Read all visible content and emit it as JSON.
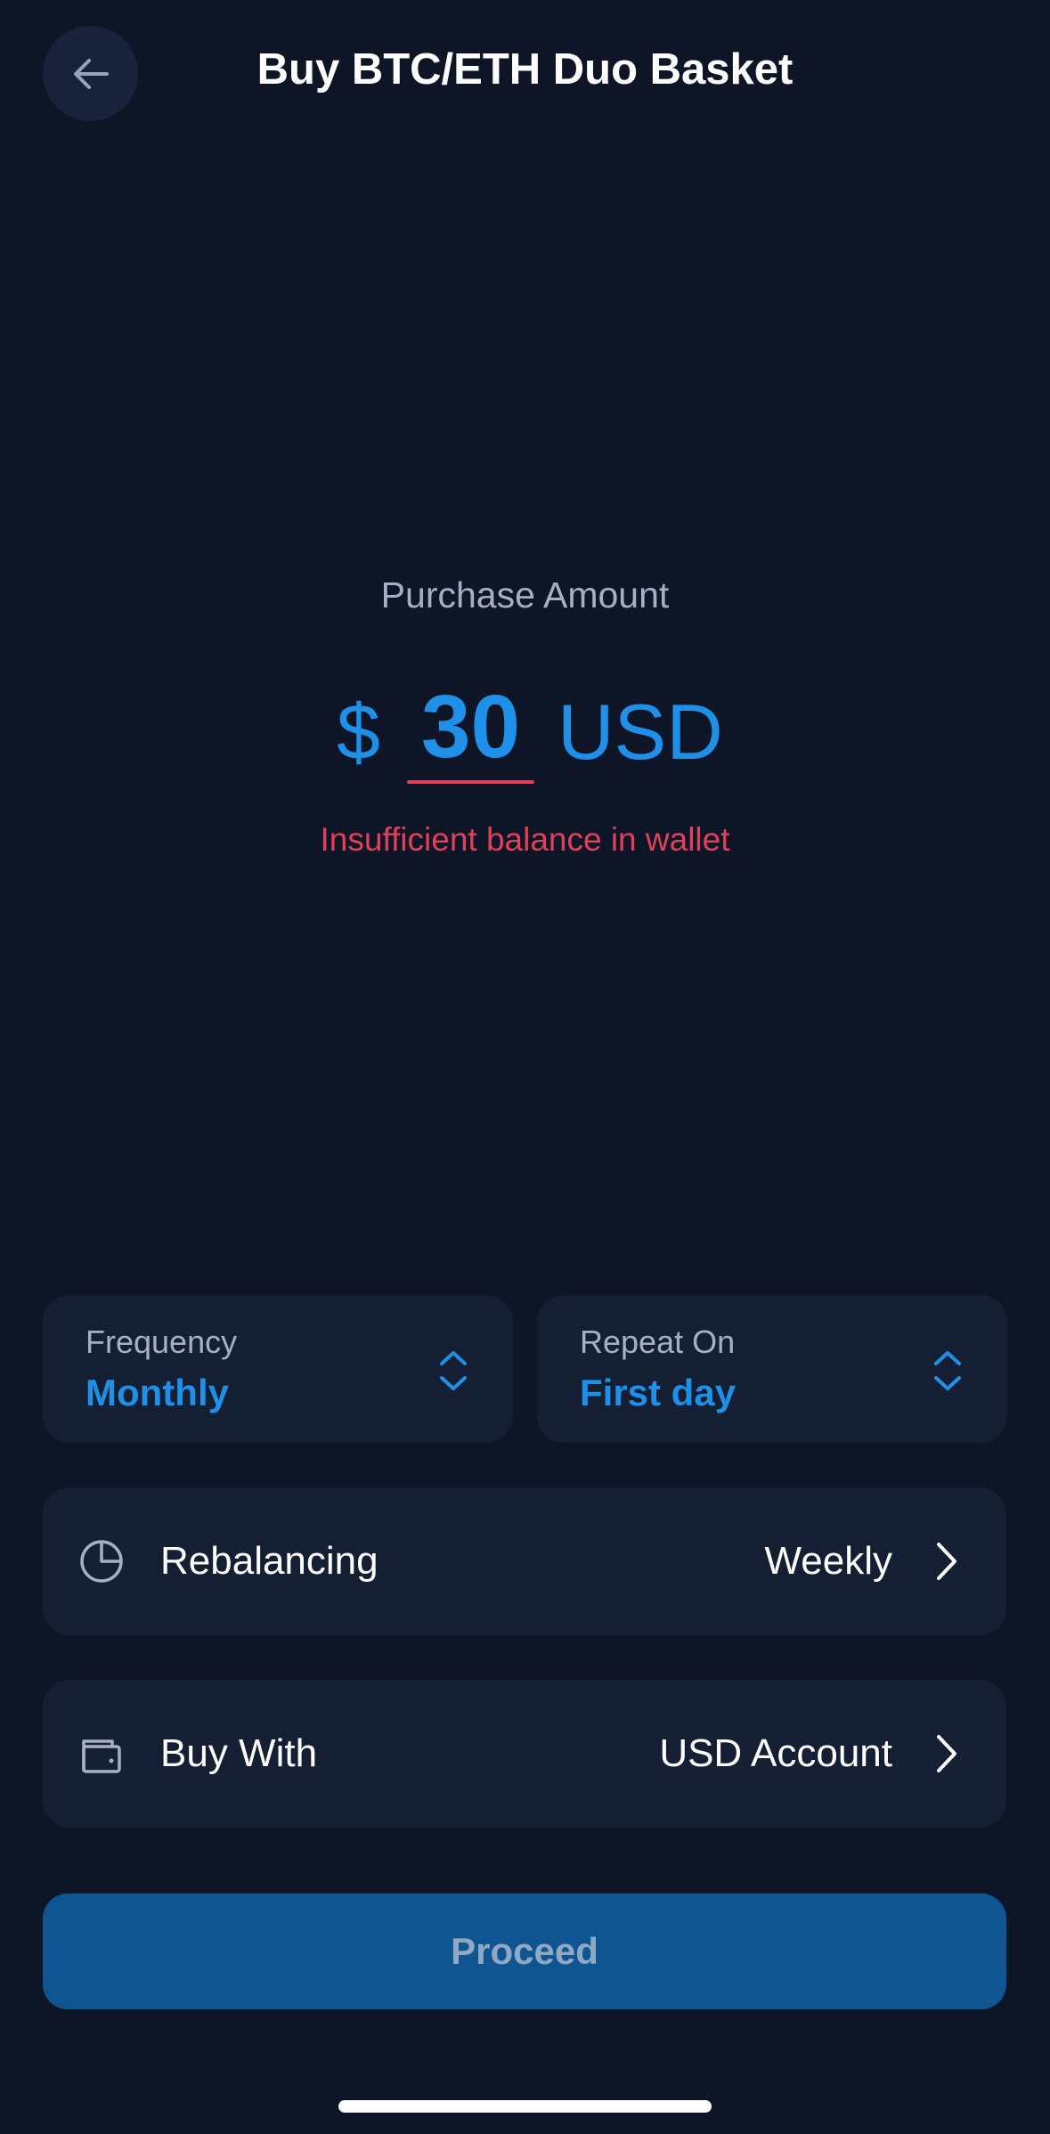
{
  "header": {
    "title": "Buy BTC/ETH Duo Basket",
    "back_icon": "arrow-left-icon"
  },
  "amount": {
    "label": "Purchase Amount",
    "currency_symbol": "$",
    "value": "30",
    "currency_code": "USD",
    "error": "Insufficient balance in wallet"
  },
  "frequency": {
    "label": "Frequency",
    "value": "Monthly",
    "icon": "chevron-up-down-icon"
  },
  "repeat_on": {
    "label": "Repeat On",
    "value": "First day",
    "icon": "chevron-up-down-icon"
  },
  "rebalancing": {
    "label": "Rebalancing",
    "value": "Weekly",
    "icon": "pie-chart-icon"
  },
  "buy_with": {
    "label": "Buy With",
    "value": "USD Account",
    "icon": "wallet-icon"
  },
  "proceed": {
    "label": "Proceed"
  },
  "colors": {
    "background": "#0d1526",
    "card": "#151f33",
    "accent": "#1e90e8",
    "error": "#e0405a",
    "button": "#0f5591",
    "button_text": "#8fa8c4",
    "muted_text": "#a7b0c2"
  }
}
